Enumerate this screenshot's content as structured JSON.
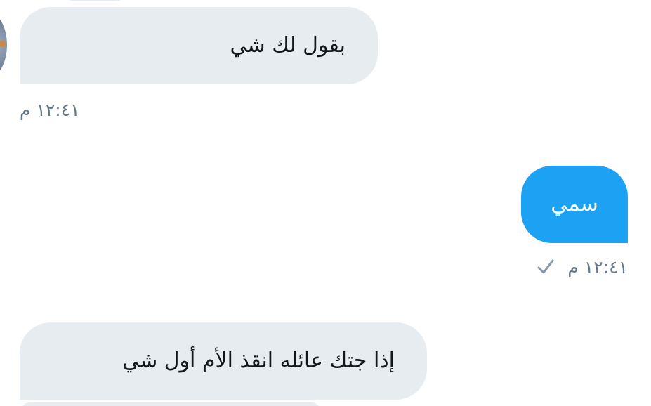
{
  "messages": [
    {
      "direction": "received",
      "text": "بقول لك شي",
      "time": "١٢:٤١ م"
    },
    {
      "direction": "sent",
      "text": "سمي",
      "time": "١٢:٤١ م",
      "status": "sent"
    },
    {
      "direction": "received",
      "text": "إذا جتك عائله انقذ الأم أول شي"
    }
  ],
  "colors": {
    "received_bubble": "#e6ecf0",
    "sent_bubble": "#1da1f2",
    "timestamp": "#657786",
    "check": "#8899a6"
  },
  "icons": {
    "sent_status": "checkmark-icon"
  }
}
